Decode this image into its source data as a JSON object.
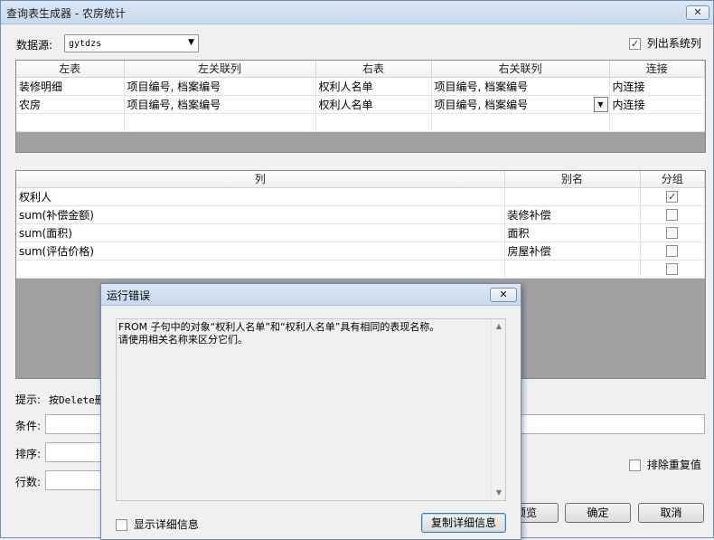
{
  "window": {
    "title": "查询表生成器 - 农房统计",
    "close_label": "✕"
  },
  "datasource": {
    "label": "数据源:",
    "value": "gytdzs"
  },
  "list_system_columns": {
    "label": "列出系统列",
    "checked": true
  },
  "join_grid": {
    "headers": [
      "左表",
      "左关联列",
      "右表",
      "右关联列",
      "连接"
    ],
    "rows": [
      [
        "装修明细",
        "项目编号, 档案编号",
        "权利人名单",
        "项目编号, 档案编号",
        "内连接"
      ],
      [
        "农房",
        "项目编号, 档案编号",
        "权利人名单",
        "项目编号, 档案编号",
        "内连接"
      ]
    ]
  },
  "column_grid": {
    "headers": [
      "列",
      "别名",
      "分组"
    ],
    "rows": [
      {
        "col": "权利人",
        "alias": "",
        "group": true
      },
      {
        "col": "sum(补偿金额)",
        "alias": "装修补偿",
        "group": false
      },
      {
        "col": "sum(面积)",
        "alias": "面积",
        "group": false
      },
      {
        "col": "sum(评估价格)",
        "alias": "房屋补偿",
        "group": false
      },
      {
        "col": "",
        "alias": "",
        "group": false
      }
    ]
  },
  "hint": {
    "label": "提示:",
    "text": "按Delete删"
  },
  "condition": {
    "label": "条件:"
  },
  "sort": {
    "label": "排序:"
  },
  "rows_count": {
    "label": "行数:"
  },
  "exclude_duplicates": {
    "label": "排除重复值",
    "checked": false
  },
  "buttons": {
    "preview": "预览",
    "ok": "确定",
    "cancel": "取消"
  },
  "error_dialog": {
    "title": "运行错误",
    "close_label": "✕",
    "message": "FROM 子句中的对象“权利人名单”和“权利人名单”具有相同的表现名称。\n请使用相关名称来区分它们。",
    "show_details_label": "显示详细信息",
    "copy_details_label": "复制详细信息"
  }
}
